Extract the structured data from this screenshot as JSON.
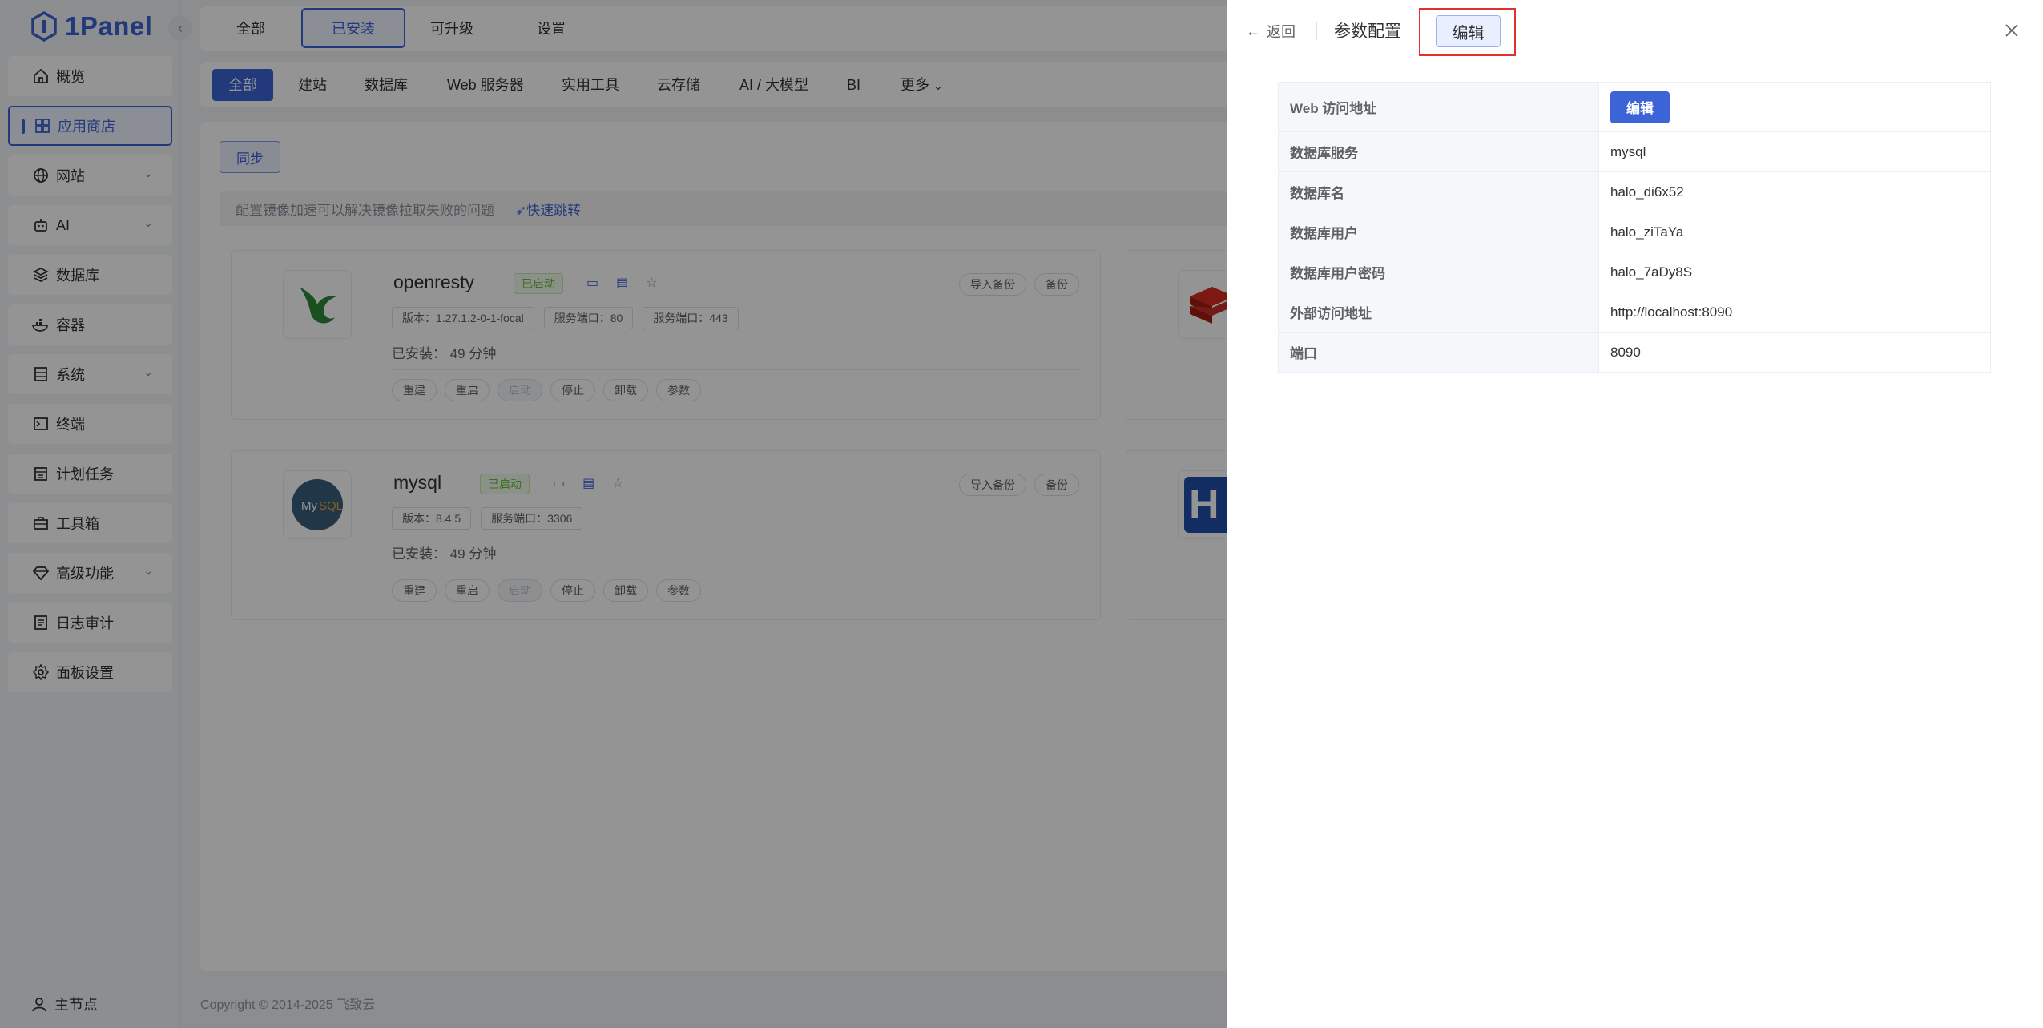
{
  "app": {
    "logo_text": "1Panel",
    "accent_color": "#3c64d6"
  },
  "sidebar": {
    "items": [
      {
        "label": "概览",
        "icon": "home-icon"
      },
      {
        "label": "应用商店",
        "icon": "grid-icon"
      },
      {
        "label": "网站",
        "icon": "globe-icon"
      },
      {
        "label": "AI",
        "icon": "robot-icon"
      },
      {
        "label": "数据库",
        "icon": "layers-icon"
      },
      {
        "label": "容器",
        "icon": "docker-icon"
      },
      {
        "label": "系统",
        "icon": "server-icon"
      },
      {
        "label": "终端",
        "icon": "terminal-icon"
      },
      {
        "label": "计划任务",
        "icon": "calendar-icon"
      },
      {
        "label": "工具箱",
        "icon": "toolbox-icon"
      },
      {
        "label": "高级功能",
        "icon": "diamond-icon"
      },
      {
        "label": "日志审计",
        "icon": "log-icon"
      },
      {
        "label": "面板设置",
        "icon": "gear-icon"
      }
    ],
    "node_label": "主节点"
  },
  "tabs": [
    "全部",
    "已安装",
    "可升级",
    "设置"
  ],
  "categories": [
    "全部",
    "建站",
    "数据库",
    "Web 服务器",
    "实用工具",
    "云存储",
    "AI / 大模型",
    "BI",
    "更多"
  ],
  "content": {
    "sync_label": "同步",
    "notice_text": "配置镜像加速可以解决镜像拉取失败的问题",
    "notice_link": "快速跳转"
  },
  "apps": [
    {
      "name": "openresty",
      "status": "已启动",
      "tags": [
        "版本：1.27.1.2-0-1-focal",
        "服务端口：80",
        "服务端口：443"
      ],
      "installed": "已安装：  49 分钟",
      "actions": [
        "重建",
        "重启",
        "启动",
        "停止",
        "卸载",
        "参数"
      ],
      "right_actions": [
        "导入备份",
        "备份"
      ]
    },
    {
      "name": "mysql",
      "status": "已启动",
      "tags": [
        "版本：8.4.5",
        "服务端口：3306"
      ],
      "installed": "已安装：  49 分钟",
      "actions": [
        "重建",
        "重启",
        "启动",
        "停止",
        "卸载",
        "参数"
      ],
      "right_actions": [
        "导入备份",
        "备份"
      ]
    }
  ],
  "footer": "Copyright © 2014-2025 飞致云",
  "drawer": {
    "back_label": "返回",
    "title": "参数配置",
    "edit_label": "编辑",
    "rows": [
      {
        "label": "Web 访问地址",
        "value": "编辑"
      },
      {
        "label": "数据库服务",
        "value": "mysql"
      },
      {
        "label": "数据库名",
        "value": "halo_di6x52"
      },
      {
        "label": "数据库用户",
        "value": "halo_ziTaYa"
      },
      {
        "label": "数据库用户密码",
        "value": "halo_7aDy8S"
      },
      {
        "label": "外部访问地址",
        "value": "http://localhost:8090"
      },
      {
        "label": "端口",
        "value": "8090"
      }
    ]
  }
}
